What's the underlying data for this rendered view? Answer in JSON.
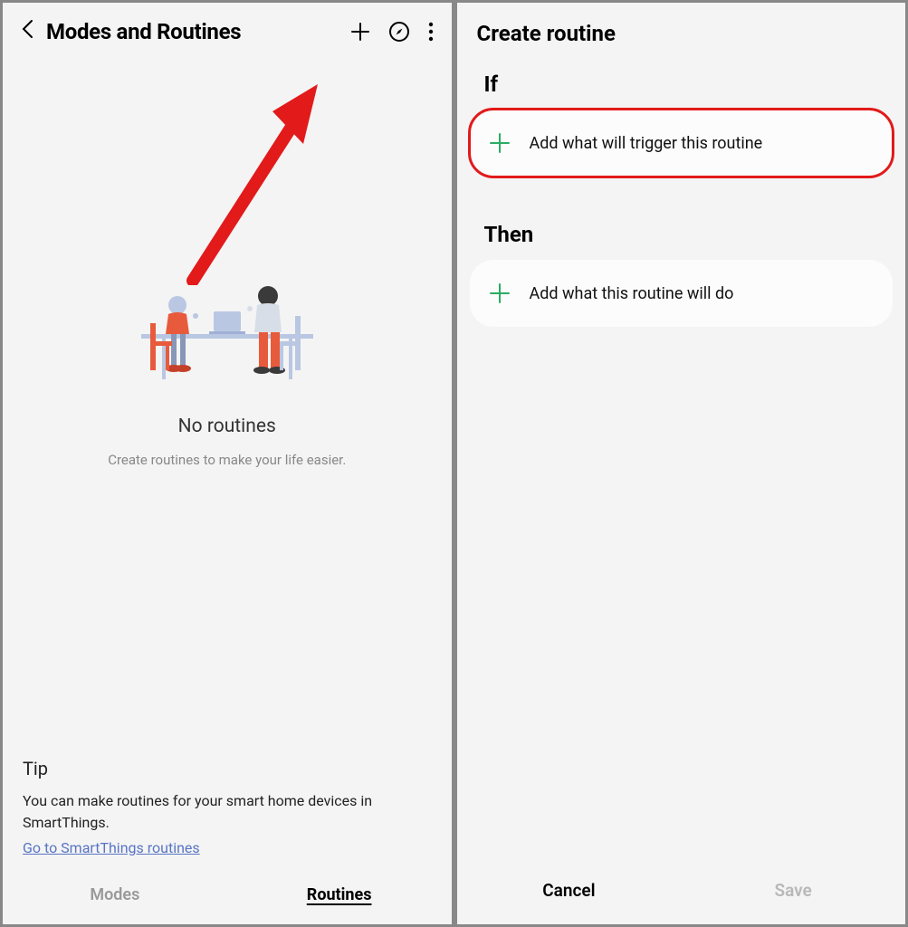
{
  "left": {
    "title": "Modes and Routines",
    "empty_title": "No routines",
    "empty_subtitle": "Create routines to make your life easier.",
    "tip": {
      "title": "Tip",
      "text": "You can make routines for your smart home devices in SmartThings.",
      "link": "Go to SmartThings routines"
    },
    "tabs": {
      "modes": "Modes",
      "routines": "Routines"
    }
  },
  "right": {
    "title": "Create routine",
    "if_label": "If",
    "if_action": "Add what will trigger this routine",
    "then_label": "Then",
    "then_action": "Add what this routine will do",
    "cancel": "Cancel",
    "save": "Save"
  },
  "colors": {
    "accent_green": "#2bab63",
    "highlight_red": "#e21a1a",
    "link_blue": "#5875c4"
  }
}
